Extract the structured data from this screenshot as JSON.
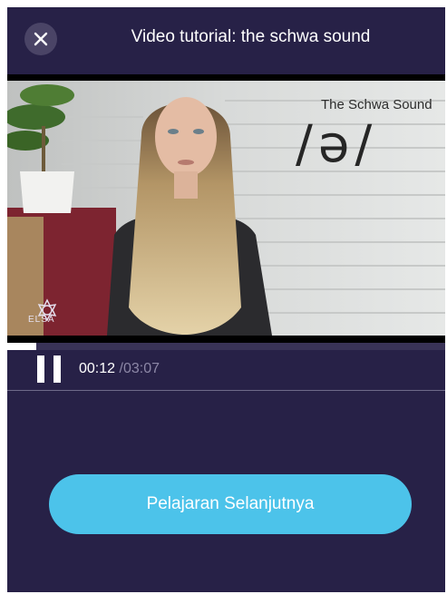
{
  "header": {
    "title": "Video tutorial: the schwa sound",
    "close_icon": "close-icon"
  },
  "video": {
    "overlay_title": "The Schwa Sound",
    "overlay_ipa": "/ə/",
    "watermark": "ELSA",
    "progress_fraction": 0.066
  },
  "controls": {
    "pause_icon": "pause-icon",
    "current_time": "00:12",
    "total_time": "/03:07"
  },
  "next_button": {
    "label": "Pelajaran Selanjutnya"
  },
  "colors": {
    "background": "#272147",
    "accent": "#4cc3ea",
    "progress": "#ffffff"
  }
}
